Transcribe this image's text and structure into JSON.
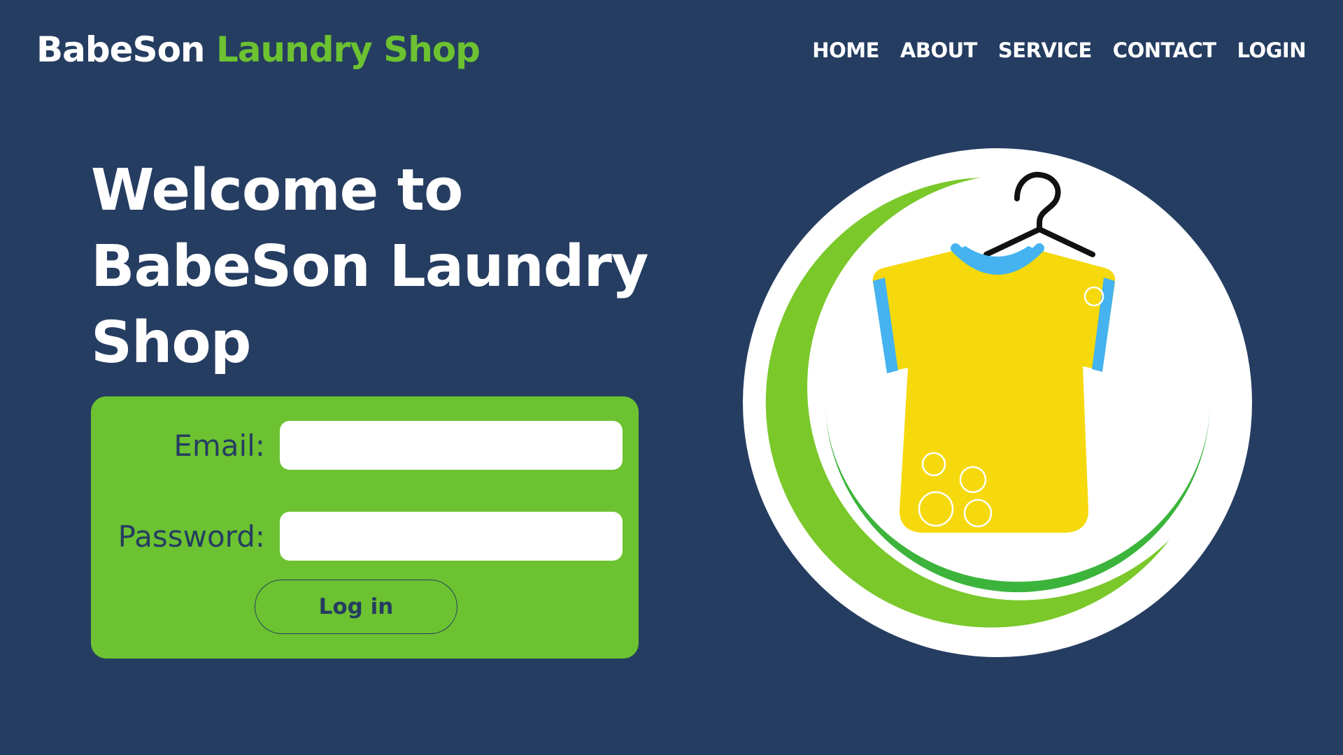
{
  "header": {
    "brand_part1": "BabeSon",
    "brand_part2": "Laundry Shop",
    "nav": [
      "HOME",
      "ABOUT",
      "SERVICE",
      "CONTACT",
      "LOGIN"
    ]
  },
  "hero": {
    "title": "Welcome to BabeSon Laundry Shop"
  },
  "login_form": {
    "email_label": "Email:",
    "email_value": "",
    "password_label": "Password:",
    "password_value": "",
    "submit_label": "Log in"
  },
  "logo": {
    "icon": "shirt-on-hanger-icon",
    "colors": {
      "circle": "#ffffff",
      "swoosh_light": "#7ac82a",
      "swoosh_dark": "#3cb43c",
      "shirt": "#f5d90c",
      "collar_sleeves": "#45b3ef",
      "hanger": "#111111"
    }
  },
  "theme": {
    "background": "#253d61",
    "accent": "#6cc231",
    "text_light": "#ffffff",
    "text_dark": "#253d61"
  }
}
